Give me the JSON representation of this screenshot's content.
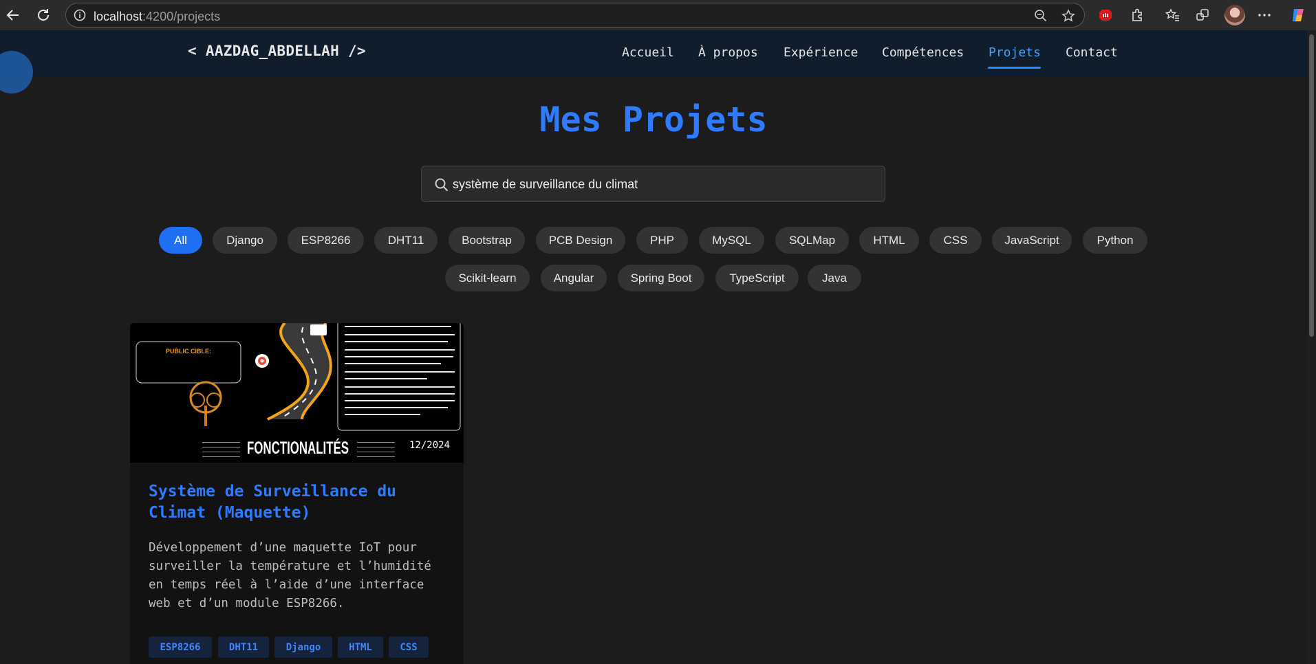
{
  "browser": {
    "url_host": "localhost",
    "url_path": ":4200/projects"
  },
  "site": {
    "logo": "< AAZDAG_ABDELLAH />",
    "nav": [
      "Accueil",
      "À propos",
      "Expérience",
      "Compétences",
      "Projets",
      "Contact"
    ],
    "active_nav": "Projets"
  },
  "main": {
    "title": "Mes Projets",
    "search_value": "système de surveillance du climat",
    "filters": [
      "All",
      "Django",
      "ESP8266",
      "DHT11",
      "Bootstrap",
      "PCB Design",
      "PHP",
      "MySQL",
      "SQLMap",
      "HTML",
      "CSS",
      "JavaScript",
      "Python",
      "Scikit-learn",
      "Angular",
      "Spring Boot",
      "TypeScript",
      "Java"
    ],
    "active_filter": "All"
  },
  "projects": [
    {
      "image": {
        "public_label": "PUBLIC CIBLE:",
        "section_label": "FONCTIONALITÉS",
        "date": "12/2024"
      },
      "title": "Système de Surveillance du Climat (Maquette)",
      "description": "Développement d’une maquette IoT pour surveiller la température et l’humidité en temps réel à l’aide d’une interface web et d’un module ESP8266.",
      "tags": [
        "ESP8266",
        "DHT11",
        "Django",
        "HTML",
        "CSS"
      ]
    }
  ],
  "colors": {
    "accent": "#2f7bff",
    "header_bg": "#0f1d2c",
    "page_bg": "#1c1c1c",
    "chip_active": "#1f6ff2"
  }
}
